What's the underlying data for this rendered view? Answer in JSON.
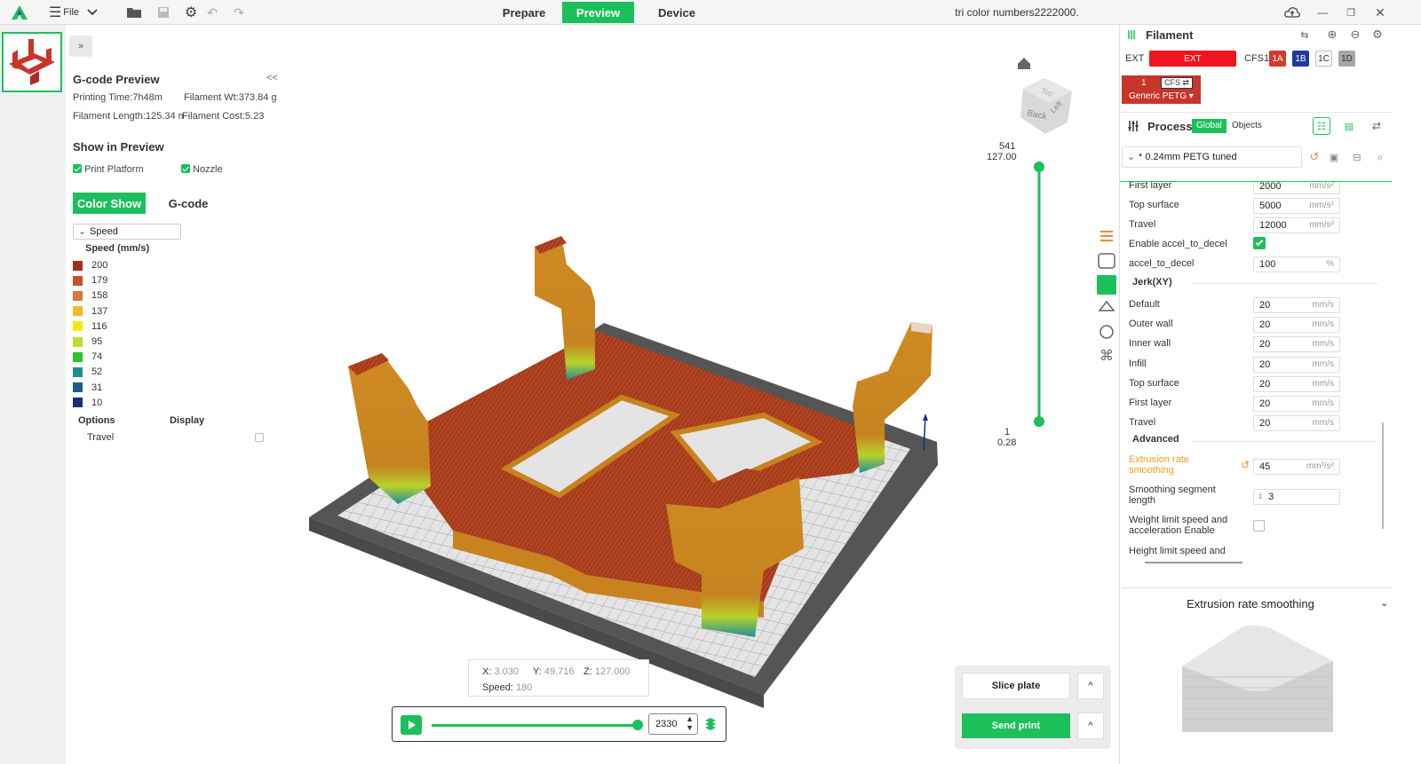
{
  "topbar": {
    "file_label": "File",
    "tabs": [
      "Prepare",
      "Preview",
      "Device"
    ],
    "active_tab": "Preview",
    "doc_title": "tri color numbers2222000."
  },
  "gcode_panel": {
    "title": "G-code Preview",
    "collapse": "<<",
    "printing_time": "Printing Time:7h48m",
    "filament_wt": "Filament Wt:373.84 g",
    "filament_length": "Filament Length:125.34 m",
    "filament_cost": "Filament Cost:5.23",
    "show_in_preview": "Show in Preview",
    "print_platform": "Print Platform",
    "nozzle": "Nozzle",
    "color_show": "Color Show",
    "gcode": "G-code",
    "view_type": "Speed",
    "legend_title": "Speed (mm/s)",
    "legend": [
      {
        "value": "200",
        "color": "#a0301e"
      },
      {
        "value": "179",
        "color": "#c3522e"
      },
      {
        "value": "158",
        "color": "#d9773a"
      },
      {
        "value": "137",
        "color": "#f0b92a"
      },
      {
        "value": "116",
        "color": "#f5ea10"
      },
      {
        "value": "95",
        "color": "#b6e22a"
      },
      {
        "value": "74",
        "color": "#2dc228"
      },
      {
        "value": "52",
        "color": "#1e8e8e"
      },
      {
        "value": "31",
        "color": "#1e5a8e"
      },
      {
        "value": "10",
        "color": "#15307a"
      }
    ],
    "options": "Options",
    "display": "Display",
    "travel": "Travel"
  },
  "viewport": {
    "top_layer": "541",
    "top_height": "127.00",
    "bottom_layer": "1",
    "bottom_height": "0.28",
    "cube_back": "Back",
    "cube_left": "Left",
    "cube_top": "Top",
    "coord_x_label": "X:",
    "coord_x": "3.030",
    "coord_y_label": "Y:",
    "coord_y": "49.716",
    "coord_z_label": "Z:",
    "coord_z": "127.000",
    "speed_label": "Speed:",
    "speed": "180",
    "move_value": "2330"
  },
  "filament": {
    "title": "Filament",
    "ext_label": "EXT",
    "ext_btn": "EXT",
    "cfs_label": "CFS1",
    "slots": [
      {
        "label": "1A",
        "color": "#d23a2a"
      },
      {
        "label": "1B",
        "color": "#1f3a9a"
      },
      {
        "label": "1C",
        "color": "#ffffff"
      },
      {
        "label": "1D",
        "color": "#a8a8a8"
      }
    ],
    "slot_num": "1",
    "slot_cfs": "CFS ⇄",
    "slot_material": "Generic PETG ▾"
  },
  "process": {
    "title": "Process",
    "global": "Global",
    "objects": "Objects",
    "profile": "* 0.24mm PETG tuned",
    "rows": [
      {
        "label": "First layer",
        "value": "2000",
        "unit": "mm/s²"
      },
      {
        "label": "Top surface",
        "value": "5000",
        "unit": "mm/s²"
      },
      {
        "label": "Travel",
        "value": "12000",
        "unit": "mm/s²"
      }
    ],
    "enable_accel": "Enable accel_to_decel",
    "accel_to_decel": "accel_to_decel",
    "accel_to_decel_value": "100",
    "accel_to_decel_unit": "%",
    "jerk_header": "Jerk(XY)",
    "jerk_rows": [
      {
        "label": "Default",
        "value": "20",
        "unit": "mm/s"
      },
      {
        "label": "Outer wall",
        "value": "20",
        "unit": "mm/s"
      },
      {
        "label": "Inner wall",
        "value": "20",
        "unit": "mm/s"
      },
      {
        "label": "Infill",
        "value": "20",
        "unit": "mm/s"
      },
      {
        "label": "Top surface",
        "value": "20",
        "unit": "mm/s"
      },
      {
        "label": "First layer",
        "value": "20",
        "unit": "mm/s"
      },
      {
        "label": "Travel",
        "value": "20",
        "unit": "mm/s"
      }
    ],
    "advanced_header": "Advanced",
    "ers_label_1": "Extrusion rate",
    "ers_label_2": "smoothing",
    "ers_value": "45",
    "ers_unit": "mm³/s²",
    "seg_label_1": "Smoothing segment",
    "seg_label_2": "length",
    "seg_value": "3",
    "wl_label_1": "Weight limit speed and",
    "wl_label_2": "acceleration Enable",
    "hl_label": "Height limit speed and"
  },
  "bottom": {
    "slice_plate": "Slice plate",
    "send_print": "Send print",
    "caret": "^",
    "ers_card_title": "Extrusion rate smoothing"
  }
}
